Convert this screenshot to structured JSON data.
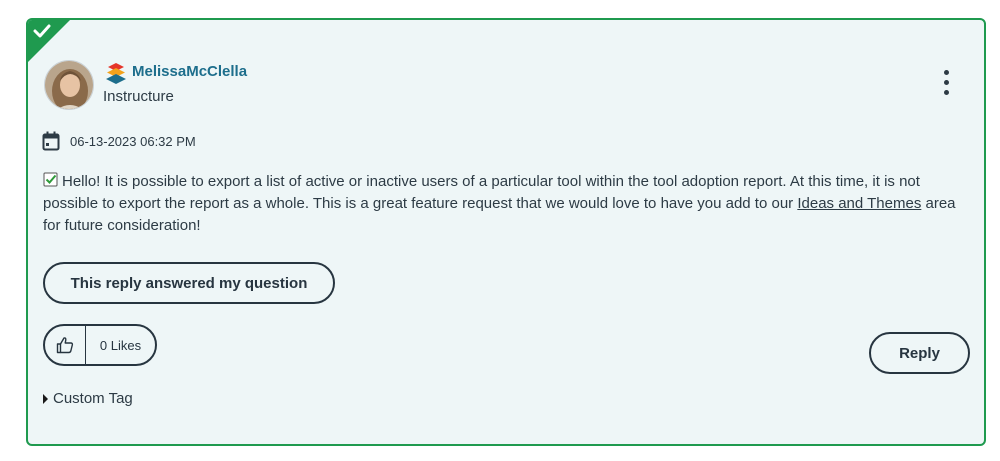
{
  "post": {
    "author": "MelissaMcClella",
    "organization": "Instructure",
    "date": "06-13-2023 06:32 PM",
    "body_part1": "Hello! It is possible to export a list of active or inactive users of a particular tool within the tool adoption report. At this time, it is not possible to export the report as a whole. This is a great feature request that we would love to have you add to our ",
    "body_link": "Ideas and Themes",
    "body_part2": " area for future consideration!",
    "accepted_solution": true
  },
  "actions": {
    "accept_label": "This reply answered my question",
    "kudos_count": "0 Likes",
    "reply_label": "Reply",
    "custom_tag_label": "Custom Tag"
  },
  "icons": {
    "corner": "accepted-solution-check-icon",
    "rank": "instructure-rank-icon",
    "menu": "kebab-menu-icon",
    "date": "calendar-icon",
    "inline": "checkbox-checked-icon",
    "kudos": "thumbs-up-icon",
    "tag": "caret-right-icon"
  },
  "colors": {
    "accent_green": "#1f9a4f",
    "card_background": "#eef6f7",
    "author_link": "#1d6e8c",
    "text": "#2d3b45"
  }
}
